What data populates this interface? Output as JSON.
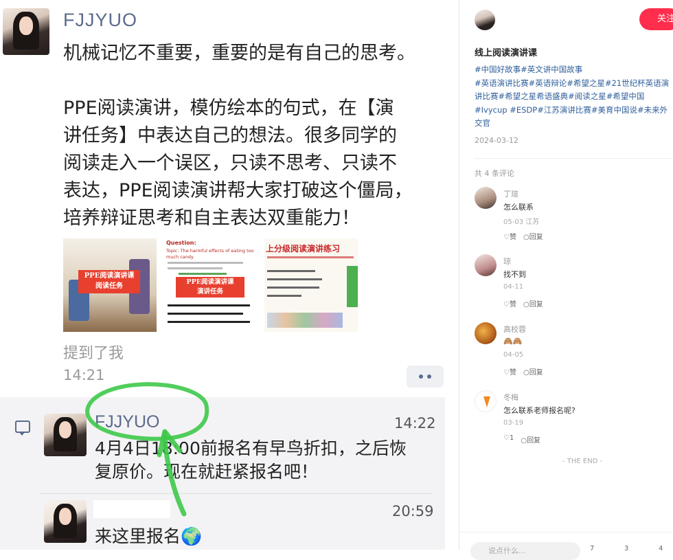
{
  "post": {
    "author": "FJJYUO",
    "line1": "机械记忆不重要，重要的是有自己的思考。",
    "paragraph": "PPE阅读演讲，模仿绘本的句式，在【演\n讲任务】中表达自己的想法。很多同学的\n阅读走入一个误区，只读不思考、只读不\n表达，PPE阅读演讲帮大家打破这个僵局，\n培养辩证思考和自主表达双重能力！",
    "images": [
      {
        "label": "PPE阅读演讲课\n阅读任务"
      },
      {
        "heading": "Question:",
        "sub": "Topic: The harmful effects of eating too much candy",
        "label": "PPE阅读演讲课\n演讲任务"
      },
      {
        "label": "上分级阅读演讲练习"
      }
    ],
    "mention": "提到了我",
    "time": "14:21"
  },
  "comments": [
    {
      "author": "FJJYUO",
      "time": "14:22",
      "text": "4月4日18:00前报名有早鸟折扣，之后恢\n复原价。现在就赶紧报名吧！"
    },
    {
      "author": "",
      "time": "20:59",
      "text": "来这里报名🌍"
    }
  ],
  "sidebar": {
    "follow_label": "关注",
    "title": "线上阅读演讲课",
    "tags": "#中国好故事#英文讲中国故事\n#英语演讲比赛#英语辩论#希望之星#21世纪杯英语演\n讲比赛#希望之星希语盛典#阅读之星#希望中国\n#Ivycup #ESDP#江苏演讲比赛#美育中国说#未来外\n交官",
    "date": "2024-03-12",
    "comment_count": "共 4 条评论",
    "comments": [
      {
        "name": "丁瑄",
        "text": "怎么联系",
        "date": "05-03 江苏",
        "likes": "♡赞",
        "reply": "回复"
      },
      {
        "name": "琼",
        "text": "找不到",
        "date": "04-11",
        "likes": "♡赞",
        "reply": "回复"
      },
      {
        "name": "高校蓉",
        "text": "🙈🙈",
        "date": "04-05",
        "likes": "♡赞",
        "reply": "回复"
      },
      {
        "name": "冬梅",
        "text": "怎么联系老师报名呢?",
        "date": "03-19",
        "likes": "♡1",
        "reply": "回复"
      }
    ],
    "the_end": "- THE END -",
    "input_placeholder": "说点什么...",
    "bottom_counts": [
      "7",
      "3",
      "4"
    ]
  },
  "colors": {
    "accent": "#ff2e4d",
    "link": "#2f5f9c",
    "name": "#5b6b8c",
    "annotation": "#3ec94a"
  }
}
